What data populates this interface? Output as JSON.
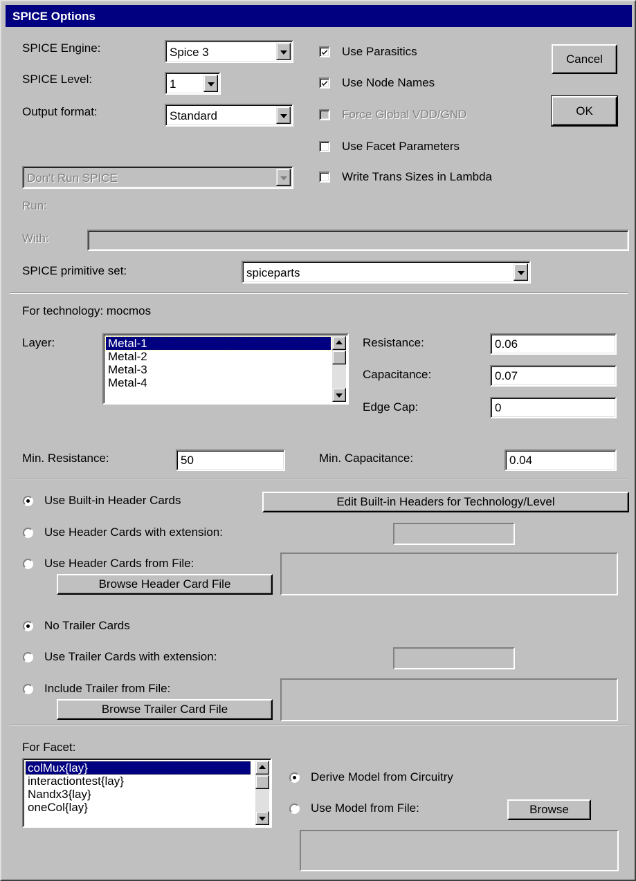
{
  "window": {
    "title": "SPICE Options"
  },
  "engine": {
    "label": "SPICE Engine:",
    "value": "Spice 3"
  },
  "level": {
    "label": "SPICE Level:",
    "value": "1"
  },
  "output_format": {
    "label": "Output format:",
    "value": "Standard"
  },
  "checkboxes": {
    "use_parasitics": {
      "label": "Use Parasitics",
      "checked": true
    },
    "use_node_names": {
      "label": "Use Node Names",
      "checked": true
    },
    "force_global": {
      "label": "Force Global VDD/GND",
      "checked": false,
      "disabled": true
    },
    "use_facet_params": {
      "label": "Use Facet Parameters",
      "checked": false
    },
    "write_trans_sizes": {
      "label": "Write Trans Sizes in Lambda",
      "checked": false
    }
  },
  "buttons": {
    "cancel": "Cancel",
    "ok": "OK"
  },
  "run_mode": {
    "value": "Don't Run SPICE"
  },
  "run": {
    "label": "Run:"
  },
  "with": {
    "label": "With:",
    "value": ""
  },
  "primitive_set": {
    "label": "SPICE primitive set:",
    "value": "spiceparts"
  },
  "technology": {
    "label": "For technology: mocmos",
    "layer_label": "Layer:",
    "layers": [
      "Metal-1",
      "Metal-2",
      "Metal-3",
      "Metal-4"
    ],
    "selected_layer": "Metal-1",
    "resistance": {
      "label": "Resistance:",
      "value": "0.06"
    },
    "capacitance": {
      "label": "Capacitance:",
      "value": "0.07"
    },
    "edge_cap": {
      "label": "Edge Cap:",
      "value": "0"
    },
    "min_resistance": {
      "label": "Min. Resistance:",
      "value": "50"
    },
    "min_capacitance": {
      "label": "Min. Capacitance:",
      "value": "0.04"
    }
  },
  "header": {
    "builtin": {
      "label": "Use Built-in Header Cards",
      "selected": true
    },
    "edit_builtin_button": "Edit Built-in Headers for Technology/Level",
    "extension": {
      "label": "Use Header Cards with extension:",
      "value": ""
    },
    "from_file": {
      "label": "Use Header Cards from File:",
      "value": ""
    },
    "browse_button": "Browse Header Card File"
  },
  "trailer": {
    "none": {
      "label": "No Trailer Cards",
      "selected": true
    },
    "extension": {
      "label": "Use Trailer Cards with extension:",
      "value": ""
    },
    "from_file": {
      "label": "Include Trailer from File:",
      "value": ""
    },
    "browse_button": "Browse Trailer Card File"
  },
  "facet": {
    "label": "For Facet:",
    "items": [
      "colMux{lay}",
      "interactiontest{lay}",
      "Nandx3{lay}",
      "oneCol{lay}"
    ],
    "selected": "colMux{lay}",
    "derive": {
      "label": "Derive Model from Circuitry",
      "selected": true
    },
    "use_file": {
      "label": "Use Model from File:",
      "selected": false
    },
    "browse_button": "Browse",
    "model_file": ""
  },
  "colors": {
    "face": "#c0c0c0",
    "title": "#000080",
    "selection": "#000080"
  }
}
